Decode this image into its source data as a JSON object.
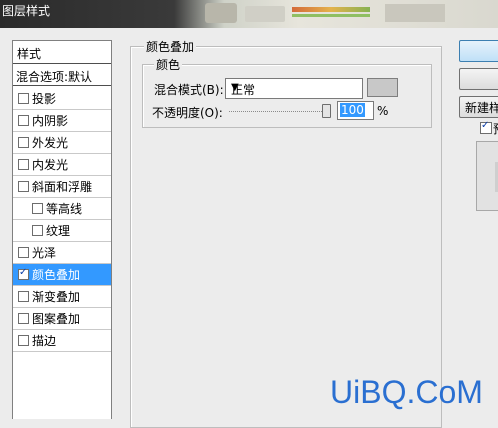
{
  "window": {
    "title": "图层样式"
  },
  "sidebar": {
    "header": "样式",
    "blend_options": "混合选项:默认",
    "items": [
      {
        "label": "投影",
        "checked": false,
        "indent": false,
        "selected": false
      },
      {
        "label": "内阴影",
        "checked": false,
        "indent": false,
        "selected": false
      },
      {
        "label": "外发光",
        "checked": false,
        "indent": false,
        "selected": false
      },
      {
        "label": "内发光",
        "checked": false,
        "indent": false,
        "selected": false
      },
      {
        "label": "斜面和浮雕",
        "checked": false,
        "indent": false,
        "selected": false
      },
      {
        "label": "等高线",
        "checked": false,
        "indent": true,
        "selected": false
      },
      {
        "label": "纹理",
        "checked": false,
        "indent": true,
        "selected": false
      },
      {
        "label": "光泽",
        "checked": false,
        "indent": false,
        "selected": false
      },
      {
        "label": "颜色叠加",
        "checked": true,
        "indent": false,
        "selected": true
      },
      {
        "label": "渐变叠加",
        "checked": false,
        "indent": false,
        "selected": false
      },
      {
        "label": "图案叠加",
        "checked": false,
        "indent": false,
        "selected": false
      },
      {
        "label": "描边",
        "checked": false,
        "indent": false,
        "selected": false
      }
    ]
  },
  "main": {
    "section_title": "颜色叠加",
    "group_title": "颜色",
    "blend_mode_label": "混合模式(B):",
    "blend_mode_value": "正常",
    "overlay_color": "#c8c8c8",
    "opacity_label": "不透明度(O):",
    "opacity_value": "100",
    "opacity_unit": "%"
  },
  "right_panel": {
    "new_style_label": "新建样",
    "preview_label": "预"
  },
  "watermark": "UiBQ.CoM",
  "colors": {
    "selection": "#3399ff",
    "watermark": "#2a6fd1"
  }
}
